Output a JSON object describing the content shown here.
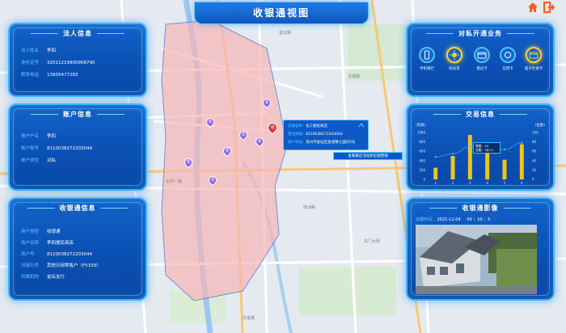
{
  "header": {
    "title": "收银通视图"
  },
  "topbar": {
    "home_icon": "home-icon",
    "exit_icon": "exit-icon",
    "accent": "#ff5a1f"
  },
  "legal_person": {
    "title": "法人信息",
    "rows": [
      {
        "label": "法人姓名",
        "value": "李四"
      },
      {
        "label": "身份证号",
        "value": "32011219900908790"
      },
      {
        "label": "联系电话",
        "value": "13905477283"
      }
    ]
  },
  "account_info": {
    "title": "账户信息",
    "rows": [
      {
        "label": "账户户名",
        "value": "李四"
      },
      {
        "label": "账户账号",
        "value": "8110038272203044"
      },
      {
        "label": "账户类型",
        "value": "对私"
      }
    ]
  },
  "cashier_info": {
    "title": "收银通信息",
    "rows": [
      {
        "label": "商户类型",
        "value": "收银通"
      },
      {
        "label": "商户名称",
        "value": "李四便民商店"
      },
      {
        "label": "商户号",
        "value": "8110038272203044"
      },
      {
        "label": "对接行号",
        "value": "其他日用零售户（F5339）"
      },
      {
        "label": "所属机构",
        "value": "金坛支行"
      }
    ]
  },
  "private_business": {
    "title": "对私开通业务",
    "items": [
      {
        "label": "手机银行",
        "icon": "mobile-icon",
        "active": false
      },
      {
        "label": "阳光贷",
        "icon": "sun-icon",
        "active": true
      },
      {
        "label": "借记卡",
        "icon": "card-icon",
        "active": false
      },
      {
        "label": "信用卡",
        "icon": "credit-icon",
        "active": false
      },
      {
        "label": "电子社保卡",
        "icon": "social-card-icon",
        "active": true
      }
    ]
  },
  "transaction_info": {
    "title": "交易信息",
    "left_unit": "(笔数)",
    "right_unit": "(金额)",
    "legend_count": "笔数：43",
    "legend_amount": "金额：783.2"
  },
  "chart_data": {
    "type": "bar",
    "categories": [
      "1",
      "2",
      "3",
      "4",
      "5",
      "6"
    ],
    "series": [
      {
        "name": "笔数",
        "values": [
          250,
          500,
          950,
          600,
          420,
          750
        ]
      },
      {
        "name": "金额",
        "type": "line",
        "values": [
          48,
          55,
          70,
          63,
          64,
          78
        ]
      }
    ],
    "ylim": [
      0,
      1000
    ],
    "yticks": [
      "0",
      "200",
      "400",
      "600",
      "800",
      "1000"
    ],
    "y2lim": [
      0,
      100
    ],
    "y2ticks": [
      "0",
      "20",
      "40",
      "60",
      "80",
      "100"
    ],
    "colors": {
      "bar": "#f0c419",
      "line": "#39c6ff"
    },
    "grid": true
  },
  "cashier_image": {
    "title": "收银通影像",
    "time_label": "拍摄时间：",
    "time_value": "2021-11-04",
    "time_extra": "09 ：10 ：5"
  },
  "map": {
    "popup": {
      "rows": [
        {
          "label": "店铺名称：",
          "value": "化工便民商店"
        },
        {
          "label": "营业执照：",
          "value": "8110038272203044"
        },
        {
          "label": "商户地址：",
          "value": "常州市金坛区金城镇七里町0号"
        }
      ],
      "link": "查看最近活动和近期营销"
    },
    "pin_label": "收",
    "labels": [
      "金坛路",
      "华城路",
      "东环一路",
      "南洲路",
      "东门大街",
      "丹金路"
    ],
    "region_color": "#f7b6b6"
  }
}
